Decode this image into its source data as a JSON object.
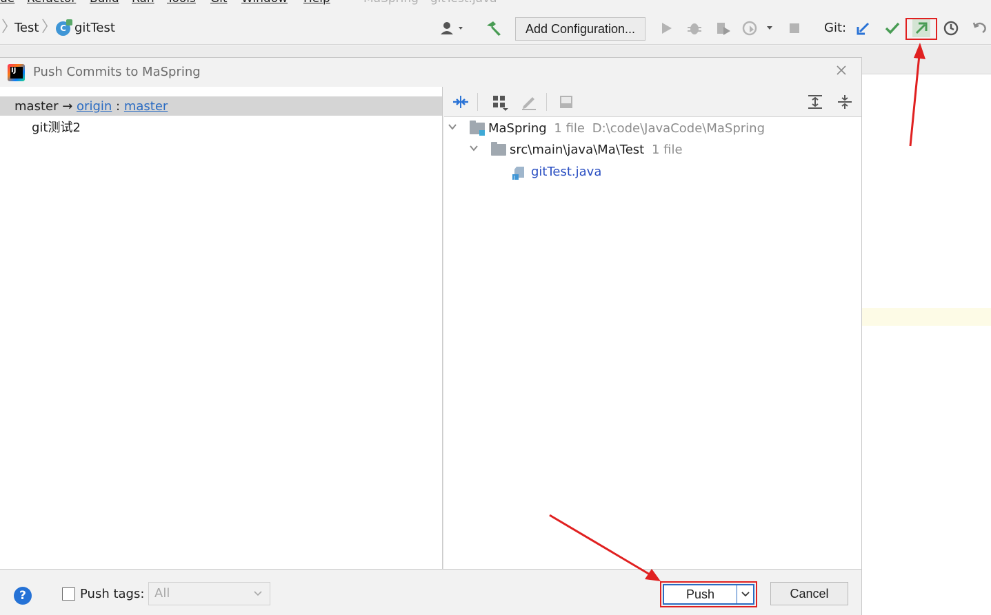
{
  "menu": {
    "items": [
      "ue",
      "Refactor",
      "Build",
      "Run",
      "Tools",
      "Git",
      "Window",
      "Help"
    ],
    "window_title": "MaSpring - gitTest.java"
  },
  "toolbar": {
    "breadcrumb": [
      "Test",
      "gitTest"
    ],
    "add_configuration_label": "Add Configuration...",
    "git_label": "Git:",
    "icons": [
      "user-icon",
      "build-hammer-icon",
      "run-icon",
      "debug-icon",
      "coverage-icon",
      "profile-icon",
      "stop-icon",
      "git-update-icon",
      "git-commit-icon",
      "git-push-icon",
      "git-history-icon",
      "git-rollback-icon"
    ]
  },
  "dialog": {
    "title": "Push Commits to MaSpring",
    "branch": {
      "local": "master",
      "arrow": "→",
      "remote": "origin",
      "separator": ":",
      "remote_branch": "master"
    },
    "commits": [
      "git测试2"
    ],
    "tree": {
      "root": {
        "name": "MaSpring",
        "count": "1 file",
        "path": "D:\\code\\JavaCode\\MaSpring"
      },
      "folder": {
        "name": "src\\main\\java\\Ma\\Test",
        "count": "1 file"
      },
      "file": {
        "name": "gitTest.java"
      }
    },
    "footer": {
      "push_tags_label": "Push tags:",
      "push_tags_value": "All",
      "push_tags_checked": false,
      "push_label": "Push",
      "cancel_label": "Cancel",
      "help_label": "?"
    }
  },
  "colors": {
    "accent": "#2a6bc2",
    "highlight_red": "#e02020",
    "git_green": "#59a869"
  }
}
